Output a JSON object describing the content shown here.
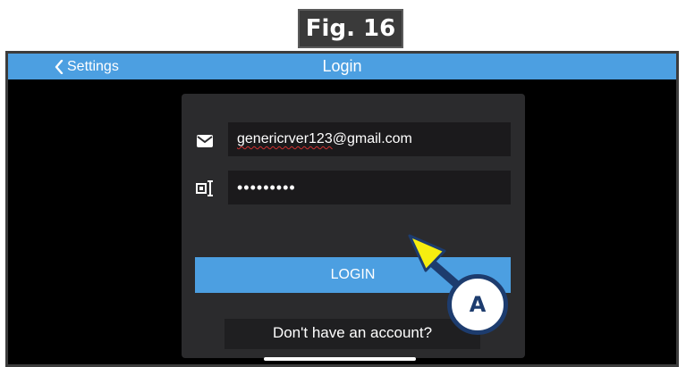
{
  "figure": {
    "label": "Fig. 16"
  },
  "navbar": {
    "back_label": "Settings",
    "title": "Login",
    "accent": "#4c9fe1"
  },
  "form": {
    "email_icon": "envelope-icon",
    "email_value_underlined": "genericrver123",
    "email_value_rest": "@gmail.com",
    "password_icon": "password-field-icon",
    "password_value": "•••••••••",
    "login_label": "LOGIN",
    "signup_label": "Don't have an account?"
  },
  "annotation": {
    "callout_letter": "A",
    "arrow_color": "#f6ee10",
    "callout_color": "#1d3c6e"
  }
}
